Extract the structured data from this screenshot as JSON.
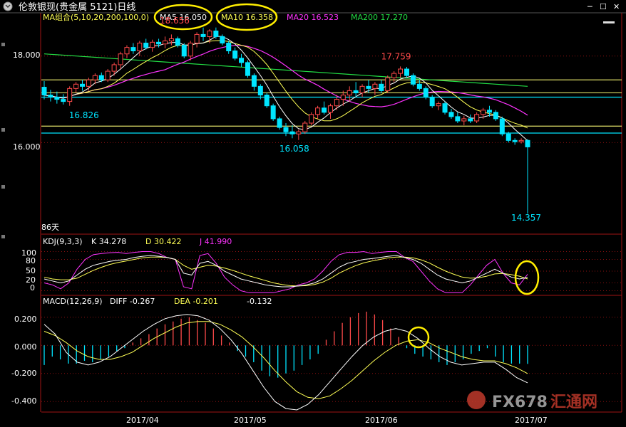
{
  "window": {
    "title": "伦敦银现(贵金属 5121)日线",
    "controls": [
      "─",
      "☐",
      "✕"
    ]
  },
  "colors": {
    "up": "#ff4a4a",
    "down": "#00e5ff",
    "ma5": "#ffffff",
    "ma10": "#ffff55",
    "ma20": "#ff33ff",
    "ma200": "#22dd44",
    "grid": "#8a1010",
    "hline": "#dddd66",
    "highlight": "#ffee00"
  },
  "panels": {
    "price": {
      "header": {
        "ma_group": "MA组合(5,10,20,200,100,0)",
        "ma5": "MA5 16.050",
        "ma10": "MA10 16.358",
        "ma20": "MA20 16.523",
        "ma200": "MA200 17.270"
      },
      "y_ticks": [
        "18.000",
        "16.000"
      ],
      "days_label": "86天"
    },
    "kdj": {
      "header": {
        "name": "KDJ(9,3,3)",
        "k": "K  34.278",
        "d": "D  30.422",
        "j": "J  41.990"
      },
      "y_ticks": [
        "100",
        "80",
        "50",
        "20",
        "0"
      ]
    },
    "macd": {
      "header": {
        "name": "MACD(12,26,9)",
        "diff": "DIFF  -0.267",
        "dea": "DEA  -0.201",
        "macd": "-0.132"
      },
      "y_ticks": [
        "0.200",
        "0.000",
        "-0.200",
        "-0.400"
      ]
    }
  },
  "x_axis": {
    "labels": [
      "2017/04",
      "2017/05",
      "2017/06",
      "2017/07"
    ]
  },
  "watermark": {
    "brand": "FX678",
    "cn": "汇通网"
  },
  "chart_data": {
    "type": "candlestick",
    "title": "伦敦银现(贵金属 5121)日线",
    "price_ylim": [
      13.9,
      19.0
    ],
    "horizontal_levels": [
      {
        "value": 17.45,
        "color": "#dddd66"
      },
      {
        "value": 17.15,
        "color": "#dddd66"
      },
      {
        "value": 17.05,
        "color": "#00e5ff"
      },
      {
        "value": 16.38,
        "color": "#dddd66"
      },
      {
        "value": 16.22,
        "color": "#00e5ff"
      }
    ],
    "annotations": [
      {
        "label": "16.826",
        "value": 16.826,
        "color": "#00e5ff"
      },
      {
        "label": "18.656",
        "value": 18.656,
        "color": "#ff4a4a"
      },
      {
        "label": "16.058",
        "value": 16.058,
        "color": "#00e5ff"
      },
      {
        "label": "17.759",
        "value": 17.759,
        "color": "#ff4a4a"
      },
      {
        "label": "14.357",
        "value": 14.357,
        "color": "#00e5ff"
      }
    ],
    "candles": [
      [
        17.28,
        17.42,
        17.0,
        17.1
      ],
      [
        17.1,
        17.22,
        16.95,
        17.05
      ],
      [
        17.05,
        17.18,
        16.9,
        17.0
      ],
      [
        17.0,
        17.12,
        16.88,
        16.95
      ],
      [
        16.95,
        17.3,
        16.85,
        17.25
      ],
      [
        17.25,
        17.4,
        17.15,
        17.35
      ],
      [
        17.35,
        17.45,
        17.2,
        17.3
      ],
      [
        17.3,
        17.5,
        17.2,
        17.45
      ],
      [
        17.45,
        17.6,
        17.35,
        17.55
      ],
      [
        17.55,
        17.62,
        17.4,
        17.45
      ],
      [
        17.45,
        17.7,
        17.4,
        17.65
      ],
      [
        17.65,
        17.85,
        17.55,
        17.8
      ],
      [
        17.8,
        18.1,
        17.7,
        18.05
      ],
      [
        18.05,
        18.25,
        17.95,
        18.2
      ],
      [
        18.2,
        18.3,
        18.05,
        18.12
      ],
      [
        18.12,
        18.35,
        18.0,
        18.3
      ],
      [
        18.3,
        18.4,
        18.15,
        18.2
      ],
      [
        18.2,
        18.38,
        18.1,
        18.32
      ],
      [
        18.32,
        18.4,
        18.2,
        18.28
      ],
      [
        18.28,
        18.45,
        18.18,
        18.35
      ],
      [
        18.35,
        18.5,
        18.25,
        18.4
      ],
      [
        18.4,
        18.45,
        18.2,
        18.25
      ],
      [
        18.25,
        18.3,
        17.95,
        18.0
      ],
      [
        18.0,
        18.35,
        17.9,
        18.3
      ],
      [
        18.3,
        18.55,
        18.2,
        18.5
      ],
      [
        18.5,
        18.66,
        18.35,
        18.45
      ],
      [
        18.45,
        18.62,
        18.3,
        18.58
      ],
      [
        18.58,
        18.66,
        18.4,
        18.45
      ],
      [
        18.45,
        18.5,
        18.25,
        18.3
      ],
      [
        18.3,
        18.35,
        18.05,
        18.12
      ],
      [
        18.12,
        18.2,
        17.9,
        17.95
      ],
      [
        17.95,
        18.05,
        17.75,
        17.85
      ],
      [
        17.85,
        17.9,
        17.5,
        17.55
      ],
      [
        17.55,
        17.6,
        17.2,
        17.3
      ],
      [
        17.3,
        17.35,
        17.0,
        17.1
      ],
      [
        17.1,
        17.15,
        16.8,
        16.85
      ],
      [
        16.85,
        16.9,
        16.5,
        16.55
      ],
      [
        16.55,
        16.6,
        16.3,
        16.35
      ],
      [
        16.35,
        16.45,
        16.15,
        16.25
      ],
      [
        16.25,
        16.4,
        16.1,
        16.2
      ],
      [
        16.2,
        16.3,
        16.06,
        16.25
      ],
      [
        16.25,
        16.5,
        16.2,
        16.45
      ],
      [
        16.45,
        16.7,
        16.4,
        16.65
      ],
      [
        16.65,
        16.85,
        16.55,
        16.8
      ],
      [
        16.8,
        16.95,
        16.65,
        16.7
      ],
      [
        16.7,
        16.9,
        16.55,
        16.85
      ],
      [
        16.85,
        17.1,
        16.75,
        17.0
      ],
      [
        17.0,
        17.2,
        16.85,
        17.1
      ],
      [
        17.1,
        17.3,
        16.95,
        17.2
      ],
      [
        17.2,
        17.4,
        17.05,
        17.15
      ],
      [
        17.15,
        17.35,
        17.05,
        17.3
      ],
      [
        17.3,
        17.45,
        17.15,
        17.25
      ],
      [
        17.25,
        17.4,
        17.1,
        17.35
      ],
      [
        17.35,
        17.45,
        17.15,
        17.2
      ],
      [
        17.2,
        17.55,
        17.15,
        17.5
      ],
      [
        17.5,
        17.65,
        17.4,
        17.6
      ],
      [
        17.6,
        17.76,
        17.5,
        17.7
      ],
      [
        17.7,
        17.75,
        17.5,
        17.55
      ],
      [
        17.55,
        17.6,
        17.3,
        17.35
      ],
      [
        17.35,
        17.45,
        17.2,
        17.25
      ],
      [
        17.25,
        17.3,
        17.0,
        17.05
      ],
      [
        17.05,
        17.1,
        16.8,
        16.85
      ],
      [
        16.85,
        16.95,
        16.75,
        16.9
      ],
      [
        16.9,
        16.95,
        16.65,
        16.7
      ],
      [
        16.7,
        16.78,
        16.55,
        16.6
      ],
      [
        16.6,
        16.7,
        16.45,
        16.5
      ],
      [
        16.5,
        16.62,
        16.4,
        16.55
      ],
      [
        16.55,
        16.65,
        16.45,
        16.5
      ],
      [
        16.5,
        16.7,
        16.45,
        16.65
      ],
      [
        16.65,
        16.8,
        16.55,
        16.75
      ],
      [
        16.75,
        16.85,
        16.6,
        16.7
      ],
      [
        16.7,
        16.75,
        16.5,
        16.55
      ],
      [
        16.55,
        16.6,
        16.15,
        16.2
      ],
      [
        16.2,
        16.25,
        16.0,
        16.05
      ],
      [
        16.05,
        16.1,
        15.95,
        16.02
      ],
      [
        16.02,
        16.1,
        15.98,
        16.05
      ],
      [
        16.05,
        16.08,
        14.357,
        15.9
      ]
    ],
    "kdj": {
      "ylim": [
        -10,
        110
      ],
      "k": [
        30,
        25,
        20,
        25,
        40,
        55,
        65,
        70,
        75,
        78,
        80,
        85,
        88,
        90,
        88,
        85,
        80,
        45,
        40,
        70,
        75,
        65,
        50,
        40,
        30,
        25,
        20,
        15,
        12,
        10,
        10,
        12,
        15,
        20,
        30,
        45,
        60,
        70,
        75,
        80,
        82,
        85,
        88,
        90,
        85,
        80,
        70,
        55,
        40,
        30,
        25,
        20,
        25,
        35,
        45,
        55,
        45,
        35,
        30,
        34
      ],
      "d": [
        35,
        30,
        28,
        28,
        32,
        42,
        52,
        60,
        67,
        72,
        76,
        80,
        84,
        86,
        86,
        85,
        80,
        65,
        55,
        60,
        65,
        63,
        58,
        52,
        45,
        38,
        32,
        26,
        20,
        16,
        13,
        12,
        13,
        16,
        22,
        32,
        45,
        55,
        64,
        71,
        76,
        80,
        84,
        86,
        86,
        84,
        79,
        71,
        60,
        50,
        42,
        35,
        32,
        33,
        37,
        43,
        44,
        41,
        37,
        30
      ],
      "j": [
        20,
        15,
        5,
        20,
        55,
        80,
        92,
        95,
        97,
        98,
        95,
        98,
        100,
        100,
        95,
        85,
        80,
        10,
        5,
        90,
        95,
        70,
        35,
        15,
        0,
        -5,
        -5,
        -5,
        -5,
        0,
        5,
        15,
        20,
        30,
        50,
        75,
        92,
        98,
        98,
        100,
        95,
        98,
        100,
        100,
        85,
        75,
        50,
        25,
        5,
        -5,
        -5,
        -5,
        15,
        40,
        65,
        80,
        45,
        20,
        15,
        42
      ]
    },
    "macd": {
      "ylim": [
        -0.47,
        0.27
      ],
      "diff": [
        0.15,
        0.08,
        -0.05,
        -0.12,
        -0.14,
        -0.12,
        -0.08,
        -0.02,
        0.04,
        0.1,
        0.15,
        0.19,
        0.21,
        0.22,
        0.21,
        0.18,
        0.12,
        0.04,
        -0.06,
        -0.18,
        -0.3,
        -0.4,
        -0.45,
        -0.46,
        -0.42,
        -0.35,
        -0.26,
        -0.17,
        -0.08,
        0.0,
        0.06,
        0.1,
        0.12,
        0.1,
        0.05,
        -0.02,
        -0.08,
        -0.12,
        -0.14,
        -0.13,
        -0.12,
        -0.12,
        -0.17,
        -0.23,
        -0.267
      ],
      "dea": [
        0.1,
        0.07,
        0.02,
        -0.04,
        -0.08,
        -0.1,
        -0.1,
        -0.08,
        -0.05,
        0.0,
        0.05,
        0.09,
        0.13,
        0.16,
        0.17,
        0.17,
        0.15,
        0.11,
        0.06,
        -0.01,
        -0.09,
        -0.18,
        -0.26,
        -0.33,
        -0.37,
        -0.38,
        -0.36,
        -0.31,
        -0.25,
        -0.18,
        -0.11,
        -0.05,
        0.0,
        0.03,
        0.04,
        0.02,
        -0.02,
        -0.05,
        -0.08,
        -0.1,
        -0.11,
        -0.11,
        -0.13,
        -0.16,
        -0.201
      ],
      "hist": [
        -0.14,
        -0.08,
        -0.1,
        -0.13,
        -0.13,
        -0.11,
        -0.12,
        -0.1,
        -0.08,
        -0.04,
        -0.02,
        0.02,
        0.05,
        0.08,
        0.12,
        0.15,
        0.17,
        0.19,
        0.2,
        0.18,
        0.16,
        0.12,
        0.07,
        0.02,
        -0.04,
        -0.08,
        -0.12,
        -0.18,
        -0.22,
        -0.23,
        -0.2,
        -0.18,
        -0.14,
        -0.1,
        -0.06,
        0.04,
        0.1,
        0.16,
        0.2,
        0.23,
        0.24,
        0.22,
        0.18,
        0.12,
        0.06,
        -0.02,
        -0.06,
        -0.08,
        -0.1,
        -0.12,
        -0.14,
        -0.12,
        -0.1,
        -0.06,
        -0.04,
        -0.02,
        -0.08,
        -0.12,
        -0.13,
        -0.13,
        -0.132
      ]
    }
  }
}
